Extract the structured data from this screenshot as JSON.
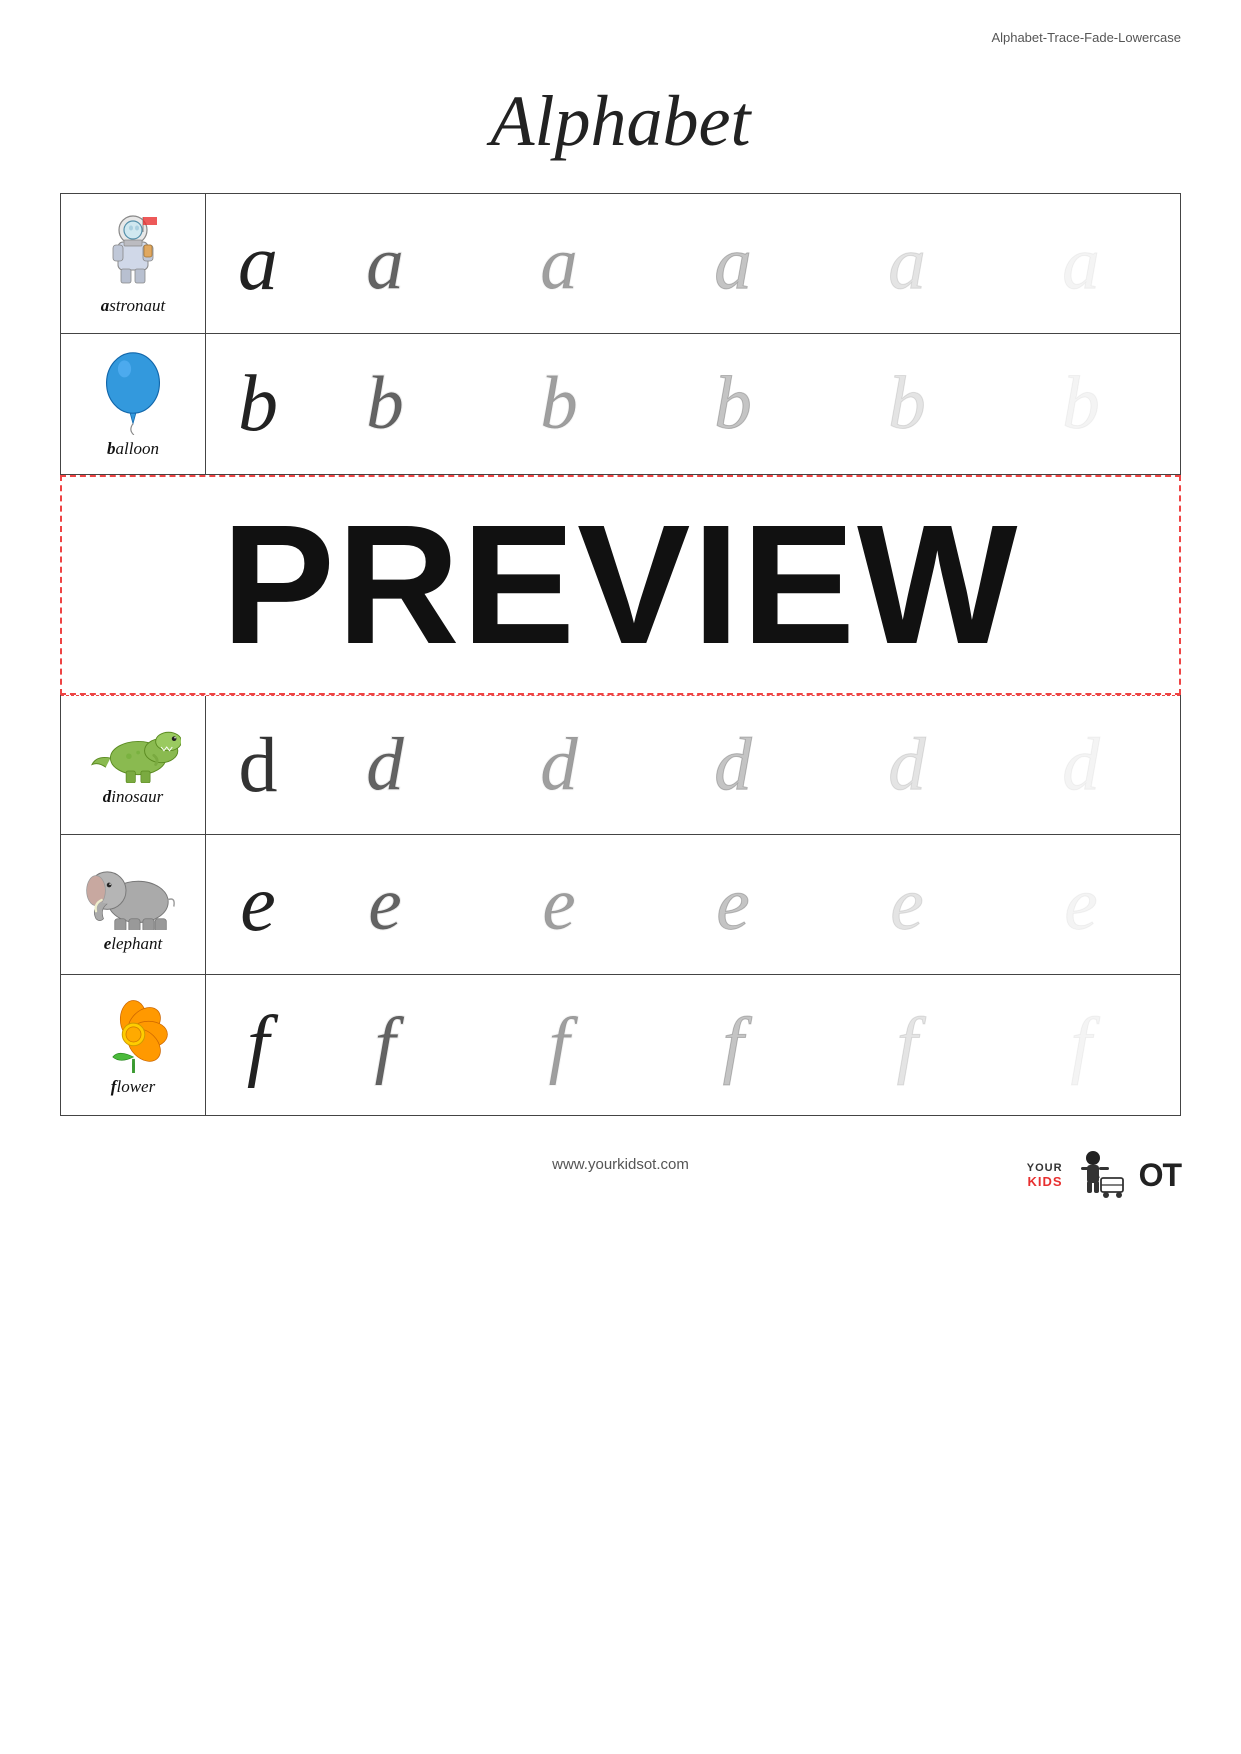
{
  "page": {
    "top_label": "Alphabet-Trace-Fade-Lowercase",
    "title": "Alphabet",
    "footer_url": "www.yourkidsot.com",
    "footer_logo": "YOUR KIDS OT",
    "preview_text": "PREVIEW"
  },
  "rows": [
    {
      "letter": "a",
      "word": "astronaut",
      "image_type": "astronaut"
    },
    {
      "letter": "b",
      "word": "balloon",
      "image_type": "balloon"
    },
    {
      "letter": "d",
      "word": "dinosaur",
      "image_type": "dinosaur"
    },
    {
      "letter": "e",
      "word": "elephant",
      "image_type": "elephant"
    },
    {
      "letter": "f",
      "word": "flower",
      "image_type": "flower"
    }
  ]
}
